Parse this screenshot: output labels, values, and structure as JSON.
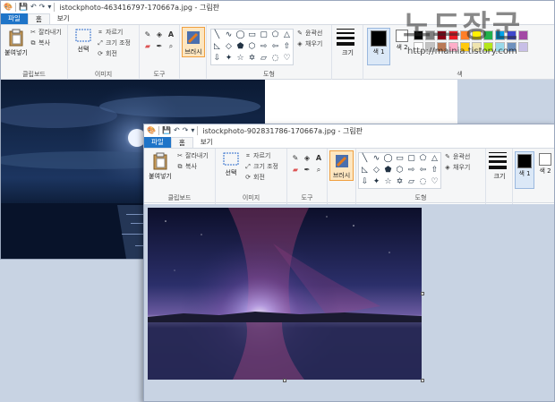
{
  "back_window": {
    "title": "istockphoto-463416797-170667a.jpg - 그림판",
    "tabs": [
      "파일",
      "홈",
      "보기"
    ]
  },
  "front_window": {
    "title": "istockphoto-902831786-170667a.jpg - 그림판",
    "tabs": [
      "파일",
      "홈",
      "보기"
    ]
  },
  "ribbon": {
    "clipboard": {
      "paste": "붙여넣기",
      "cut": "잘라내기",
      "copy": "복사",
      "label": "클립보드"
    },
    "image": {
      "select": "선택",
      "crop": "자르기",
      "resize": "크기 조정",
      "rotate": "회전",
      "label": "이미지"
    },
    "tools": {
      "label": "도구"
    },
    "brushes": {
      "label": "브러시"
    },
    "shapes": {
      "outline": "윤곽선",
      "fill": "채우기",
      "label": "도형"
    },
    "size": {
      "label": "크기"
    },
    "colors": {
      "color1": "색 1",
      "color2": "색 2",
      "label": "색",
      "palette": [
        "#000000",
        "#7f7f7f",
        "#880015",
        "#ed1c24",
        "#ff7f27",
        "#fff200",
        "#22b14c",
        "#00a2e8",
        "#3f48cc",
        "#a349a4",
        "#ffffff",
        "#c3c3c3",
        "#b97a57",
        "#ffaec9",
        "#ffc90e",
        "#efe4b0",
        "#b5e61d",
        "#99d9ea",
        "#7092be",
        "#c8bfe7"
      ]
    }
  },
  "watermark": {
    "title": "노드장군",
    "url": "http://mainia.tistory.com"
  }
}
